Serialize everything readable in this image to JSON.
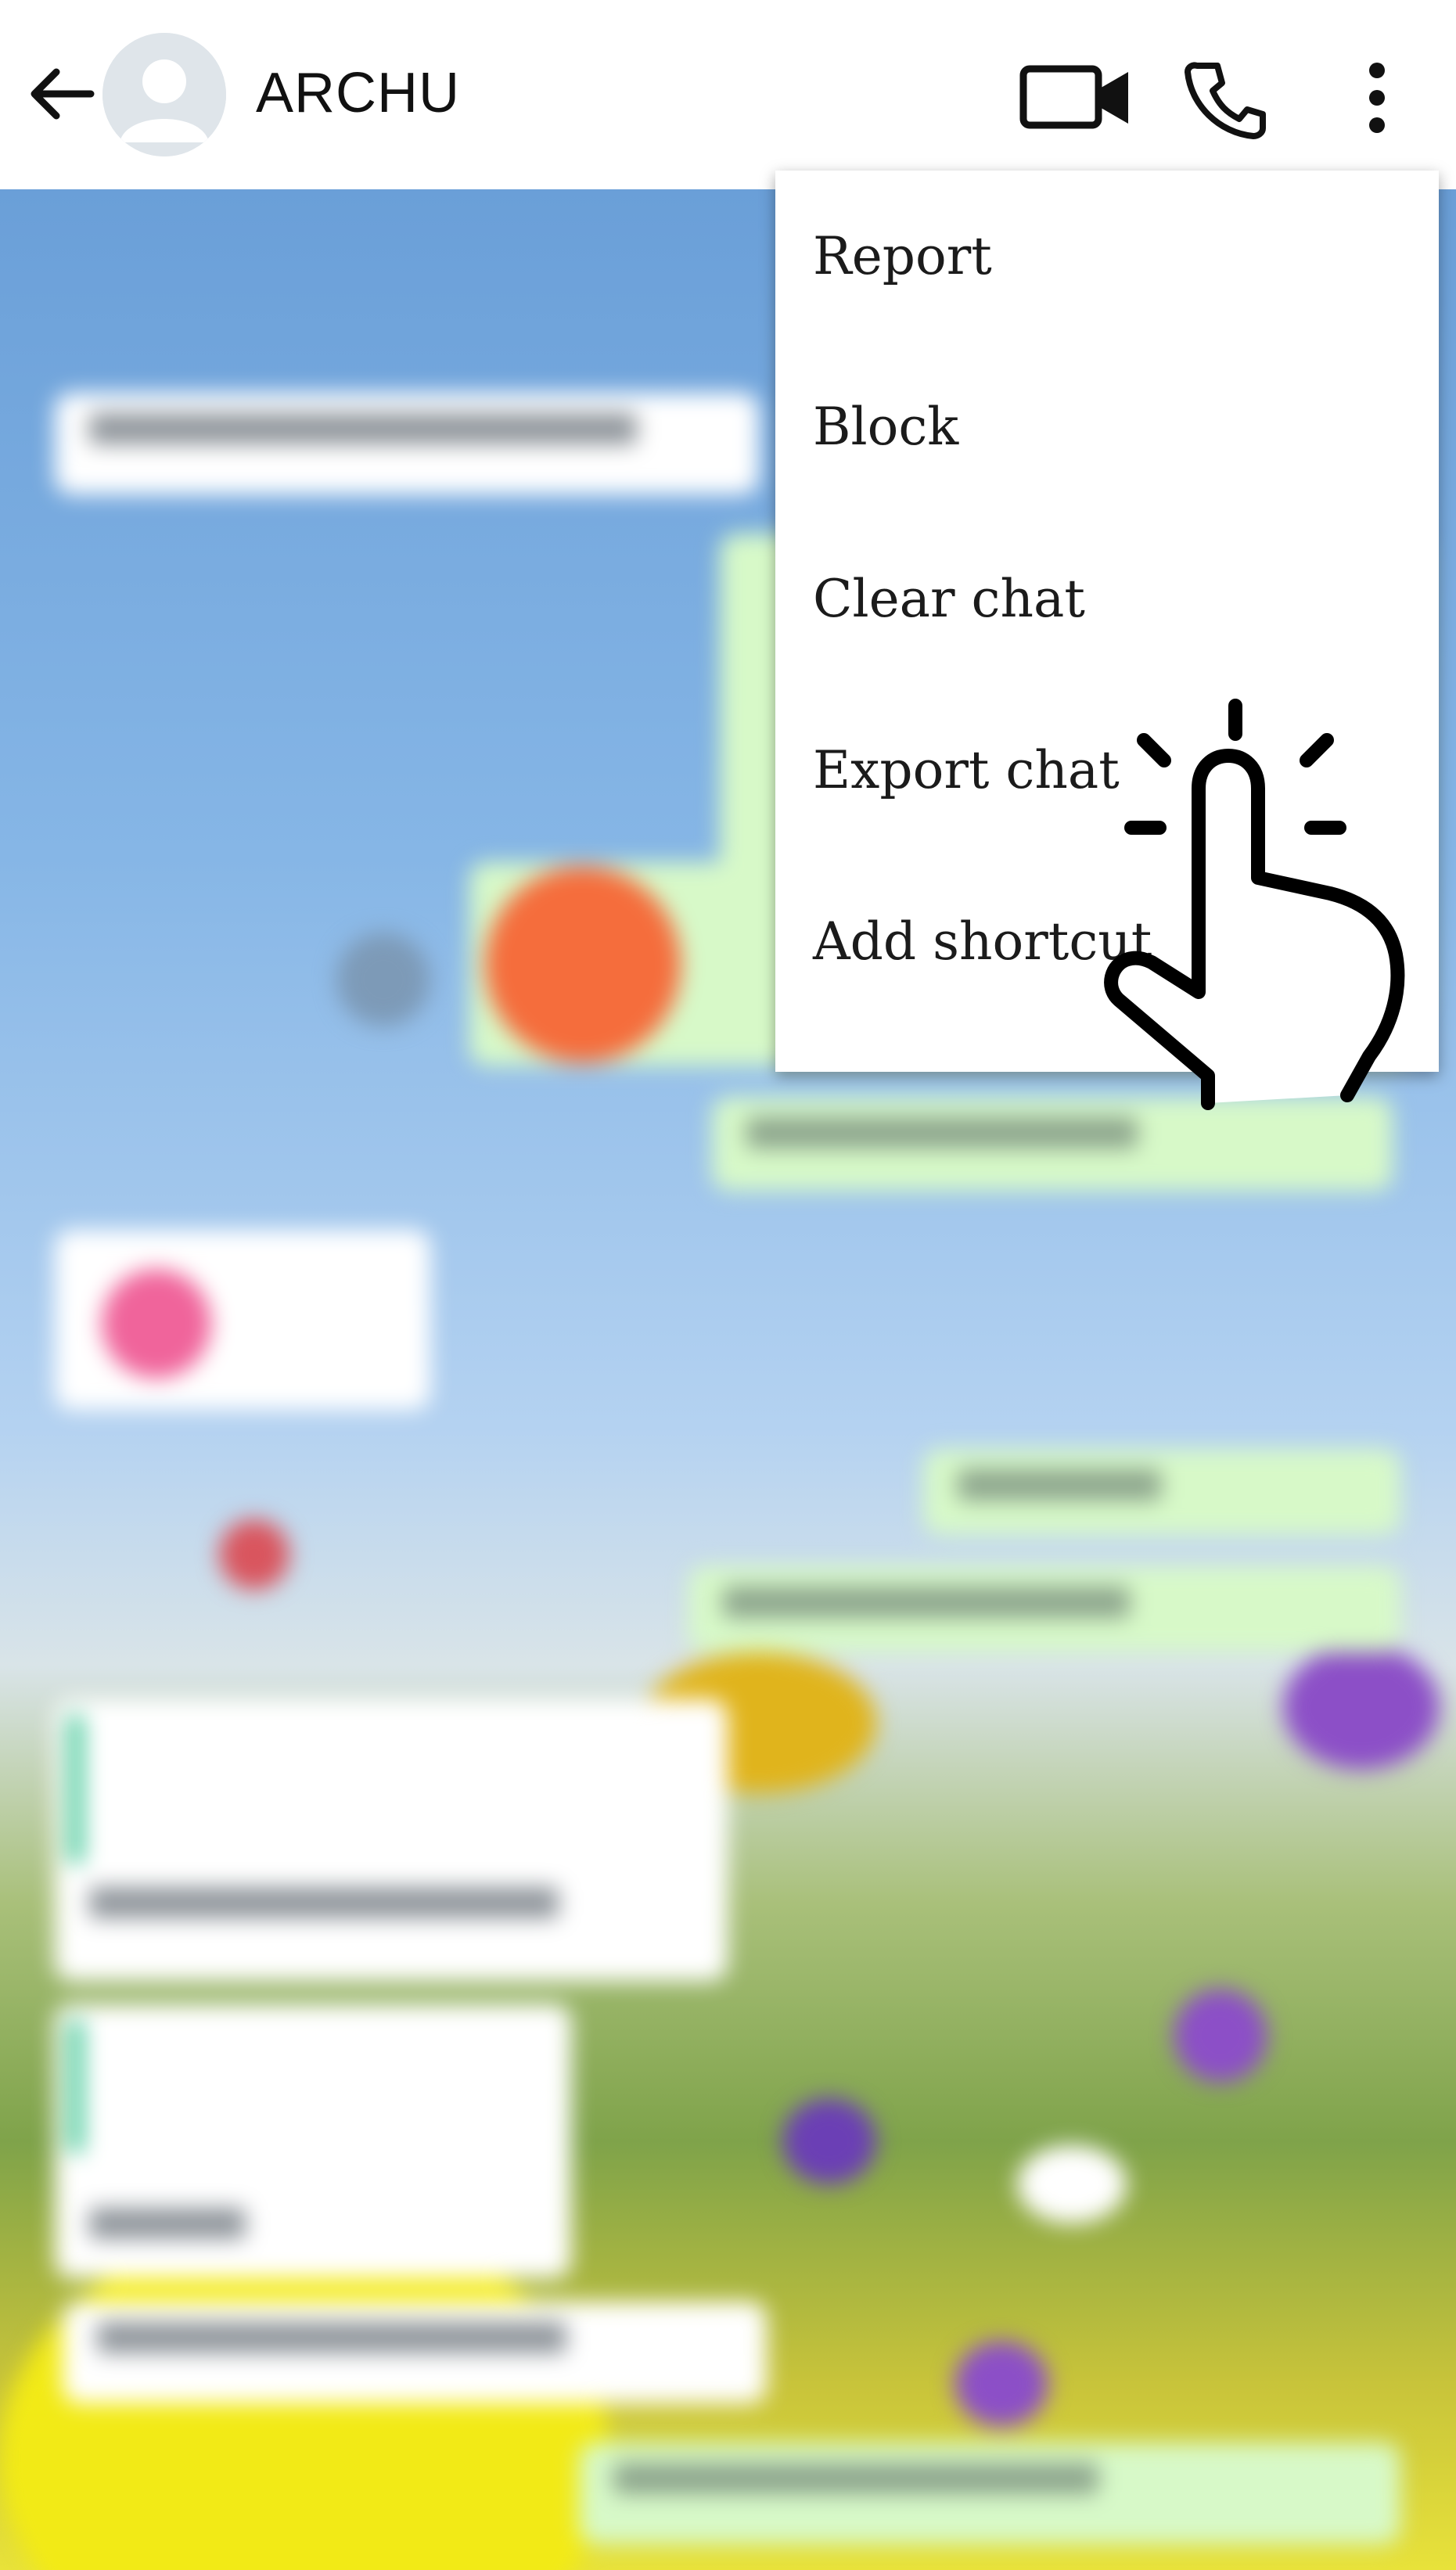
{
  "header": {
    "contact_name": "ARCHU",
    "back_icon": "arrow-left-icon",
    "avatar_icon": "default-user-avatar-icon",
    "video_icon": "video-camera-icon",
    "call_icon": "phone-icon",
    "more_icon": "more-vertical-icon"
  },
  "menu": {
    "items": [
      {
        "label": "Report"
      },
      {
        "label": "Block"
      },
      {
        "label": "Clear chat"
      },
      {
        "label": "Export chat"
      },
      {
        "label": "Add shortcut"
      }
    ]
  },
  "overlay": {
    "tap_icon": "tap-hand-icon"
  },
  "colors": {
    "incoming_bubble": "#ffffff",
    "outgoing_bubble": "#d7f9c8",
    "menu_background": "#ffffff",
    "sky": "#86b6e6"
  }
}
